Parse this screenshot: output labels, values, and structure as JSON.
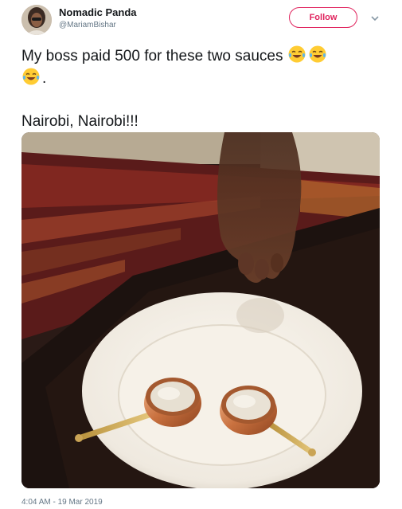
{
  "user": {
    "display_name": "Nomadic Panda",
    "handle": "@MariamBishar"
  },
  "actions": {
    "follow_label": "Follow"
  },
  "tweet": {
    "line1": "My boss paid 500 for these two sauces",
    "line2_suffix": ".",
    "line3": "Nairobi, Nairobi!!!"
  },
  "icons": {
    "emoji": "face-with-tears-of-joy-icon",
    "menu": "chevron-down-icon"
  },
  "colors": {
    "follow_accent": "#e0245e",
    "text_primary": "#14171a",
    "text_secondary": "#657786"
  },
  "meta": {
    "timestamp": "4:04 AM - 19 Mar 2019"
  }
}
